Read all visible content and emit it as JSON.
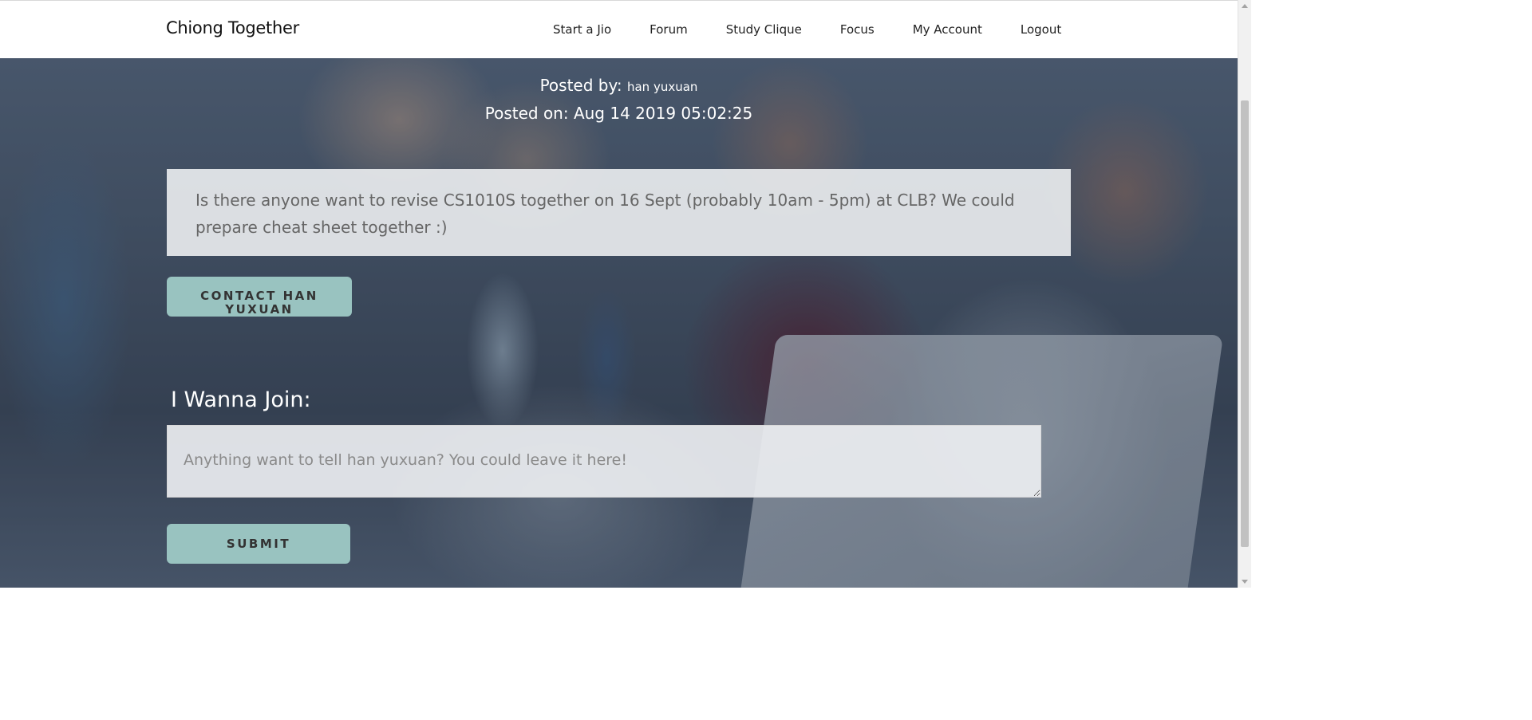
{
  "nav": {
    "brand": "Chiong Together",
    "links": [
      {
        "label": "Start a Jio"
      },
      {
        "label": "Forum"
      },
      {
        "label": "Study Clique"
      },
      {
        "label": "Focus"
      },
      {
        "label": "My Account"
      },
      {
        "label": "Logout"
      }
    ]
  },
  "post": {
    "posted_by_label": "Posted by:",
    "author": "han yuxuan",
    "posted_on": "Posted on: Aug 14 2019 05:02:25",
    "content": "Is there anyone want to revise CS1010S together on 16 Sept (probably 10am - 5pm) at CLB? We could prepare cheat sheet together :)",
    "contact_button": "CONTACT HAN YUXUAN"
  },
  "join": {
    "heading": "I Wanna Join:",
    "placeholder": "Anything want to tell han yuxuan? You could leave it here!",
    "submit": "SUBMIT"
  },
  "colors": {
    "button_bg": "#99c3c0",
    "nav_bg": "#ffffff"
  }
}
